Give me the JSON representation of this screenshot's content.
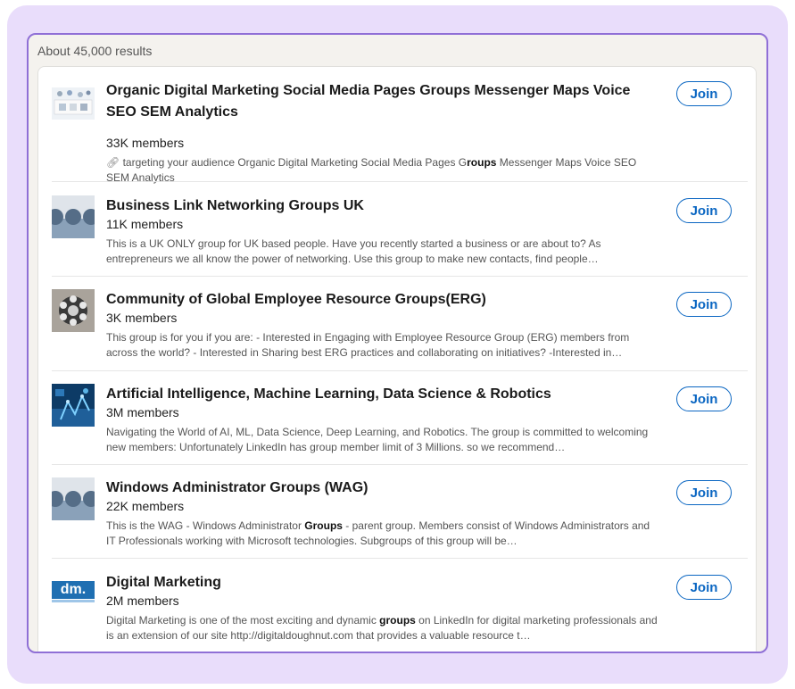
{
  "results_count": "About 45,000 results",
  "join_label": "Join",
  "colors": {
    "accent": "#0a66c2",
    "frame": "#8f6fd6",
    "backdrop": "#e9ddfb"
  },
  "groups": [
    {
      "name": "Organic Digital Marketing Social Media Pages Groups Messenger Maps Voice SEO SEM Analytics",
      "members": "33K members",
      "snippet_pre": "targeting your audience Organic Digital Marketing Social Media Pages G",
      "snippet_bold": "roups",
      "snippet_post": " Messenger Maps Voice SEO SEM Analytics"
    },
    {
      "name": "Business Link Networking Groups UK",
      "members": "11K members",
      "snippet_pre": "This is a UK ONLY group for UK based people. Have you recently started a business or are about to? As entrepreneurs we all know the power of networking. Use this group to make new contacts, find people…",
      "snippet_bold": "",
      "snippet_post": ""
    },
    {
      "name": "Community of Global Employee Resource Groups(ERG)",
      "members": "3K members",
      "snippet_pre": "This group is for you if you are: - Interested in Engaging with Employee Resource Group (ERG) members from across the world? - Interested in Sharing best ERG practices and collaborating on initiatives? -Interested in…",
      "snippet_bold": "",
      "snippet_post": ""
    },
    {
      "name": "Artificial Intelligence, Machine Learning, Data Science & Robotics",
      "members": "3M members",
      "snippet_pre": "Navigating the World of AI, ML, Data Science, Deep Learning, and Robotics. The group is committed to welcoming new members: Unfortunately LinkedIn has group member limit of 3 Millions. so we recommend…",
      "snippet_bold": "",
      "snippet_post": ""
    },
    {
      "name": "Windows Administrator Groups (WAG)",
      "members": "22K members",
      "snippet_pre": "This is the WAG - Windows Administrator ",
      "snippet_bold": "Groups",
      "snippet_post": " - parent group. Members consist of Windows Administrators and IT Professionals working with Microsoft technologies. Subgroups of this group will be…"
    },
    {
      "name": "Digital Marketing",
      "members": "2M members",
      "logo_text": "dm.",
      "snippet_pre": "Digital Marketing is one of the most exciting and dynamic ",
      "snippet_bold": "groups",
      "snippet_post": " on LinkedIn for digital marketing professionals and is an extension of our site http://digitaldoughnut.com that provides a valuable resource t…"
    }
  ]
}
